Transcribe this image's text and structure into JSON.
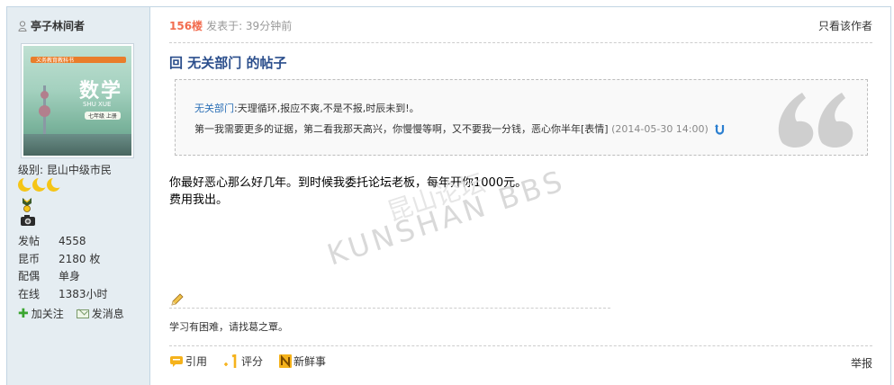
{
  "author": {
    "name": "亭子林间者",
    "level_label": "级别:",
    "level_value": "昆山中级市民"
  },
  "avatar": {
    "band_text": "义务教育教科书",
    "title": "数学",
    "sub1": "SHU XUE",
    "sub2": "七年级 上册"
  },
  "stats": [
    {
      "k": "发帖",
      "v": "4558"
    },
    {
      "k": "昆币",
      "v": "2180 枚"
    },
    {
      "k": "配偶",
      "v": "单身"
    },
    {
      "k": "在线",
      "v": "1383小时"
    }
  ],
  "side_actions": {
    "follow": "加关注",
    "message": "发消息"
  },
  "post": {
    "floor": "156楼",
    "posted": "发表于: 39分钟前",
    "only_author": "只看该作者",
    "title": "回 无关部门 的帖子",
    "quote_user": "无关部门",
    "quote_line1": ":天理循环,报应不爽,不是不报,时辰未到!。",
    "quote_line2": "第一我需要更多的证据，第二看我那天高兴，你慢慢等啊，又不要我一分钱，恶心你半年[表情]",
    "quote_date": "(2014-05-30 14:00)",
    "content_line1": "你最好恶心那么好几年。到时候我委托论坛老板，每年开你1000元。",
    "content_line2": "费用我出。",
    "signature": "学习有困难，请找葛之覃。",
    "watermark": "KUNSHAN BBS",
    "watermark_cn": "昆山论坛"
  },
  "ops": {
    "quote": "引用",
    "rate": "评分",
    "fresh": "新鲜事",
    "report": "举报"
  },
  "colors": {
    "sidebar_bg": "#e5edf2",
    "border": "#c2d5e3",
    "floor": "#f26c4f",
    "title": "#2b4e8c",
    "link": "#2b6fb6"
  }
}
